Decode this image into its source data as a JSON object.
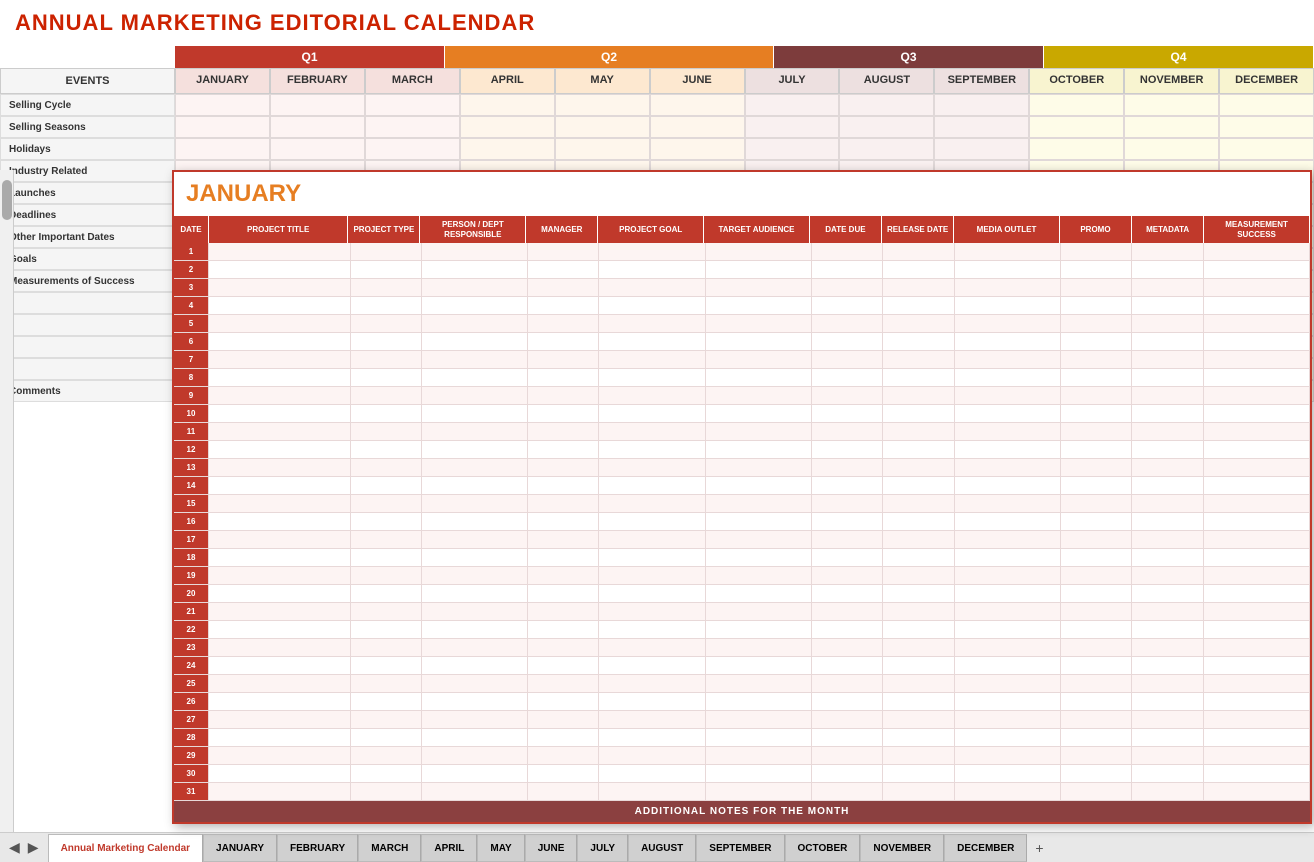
{
  "title": "ANNUAL MARKETING EDITORIAL CALENDAR",
  "quarters": [
    {
      "label": "Q1",
      "class": "q1"
    },
    {
      "label": "Q2",
      "class": "q2"
    },
    {
      "label": "Q3",
      "class": "q3"
    },
    {
      "label": "Q4",
      "class": "q4"
    }
  ],
  "months": [
    {
      "label": "JANUARY",
      "quarter": "q1"
    },
    {
      "label": "FEBRUARY",
      "quarter": "q1"
    },
    {
      "label": "MARCH",
      "quarter": "q1"
    },
    {
      "label": "APRIL",
      "quarter": "q2"
    },
    {
      "label": "MAY",
      "quarter": "q2"
    },
    {
      "label": "JUNE",
      "quarter": "q2"
    },
    {
      "label": "JULY",
      "quarter": "q3"
    },
    {
      "label": "AUGUST",
      "quarter": "q3"
    },
    {
      "label": "SEPTEMBER",
      "quarter": "q3"
    },
    {
      "label": "OCTOBER",
      "quarter": "q4"
    },
    {
      "label": "NOVEMBER",
      "quarter": "q4"
    },
    {
      "label": "DECEMBER",
      "quarter": "q4"
    }
  ],
  "events_header": "EVENTS",
  "event_rows": [
    "Selling Cycle",
    "Selling Seasons",
    "Holidays",
    "Industry Related",
    "Launches",
    "Deadlines",
    "Other Important Dates",
    "Goals",
    "Measurements of Success",
    "",
    "",
    "",
    "",
    "Comments"
  ],
  "january": {
    "title": "JANUARY",
    "headers": [
      "DATE",
      "PROJECT TITLE",
      "PROJECT TYPE",
      "PERSON / DEPT RESPONSIBLE",
      "MANAGER",
      "PROJECT GOAL",
      "TARGET AUDIENCE",
      "DATE DUE",
      "RELEASE DATE",
      "MEDIA OUTLET",
      "PROMO",
      "METADATA",
      "MEASUREMENT SUCCESS"
    ],
    "days": [
      1,
      2,
      3,
      4,
      5,
      6,
      7,
      8,
      9,
      10,
      11,
      12,
      13,
      14,
      15,
      16,
      17,
      18,
      19,
      20,
      21,
      22,
      23,
      24,
      25,
      26,
      27,
      28,
      29,
      30,
      31
    ],
    "additional_notes": "ADDITIONAL NOTES FOR THE MONTH"
  },
  "tabs": [
    {
      "label": "Annual Marketing Calendar",
      "active": true
    },
    {
      "label": "JANUARY",
      "active": false
    },
    {
      "label": "FEBRUARY",
      "active": false
    },
    {
      "label": "MARCH",
      "active": false
    },
    {
      "label": "APRIL",
      "active": false
    },
    {
      "label": "MAY",
      "active": false
    },
    {
      "label": "JUNE",
      "active": false
    },
    {
      "label": "JULY",
      "active": false
    },
    {
      "label": "AUGUST",
      "active": false
    },
    {
      "label": "SEPTEMBER",
      "active": false
    },
    {
      "label": "OCTOBER",
      "active": false
    },
    {
      "label": "NOVEMBER",
      "active": false
    },
    {
      "label": "DECEMBER",
      "active": false
    }
  ],
  "colors": {
    "q1_bg": "#c0392b",
    "q2_bg": "#e67e22",
    "q3_bg": "#7d3c3c",
    "q4_bg": "#c9a800",
    "title_color": "#cc2200",
    "january_title": "#e67e22"
  }
}
